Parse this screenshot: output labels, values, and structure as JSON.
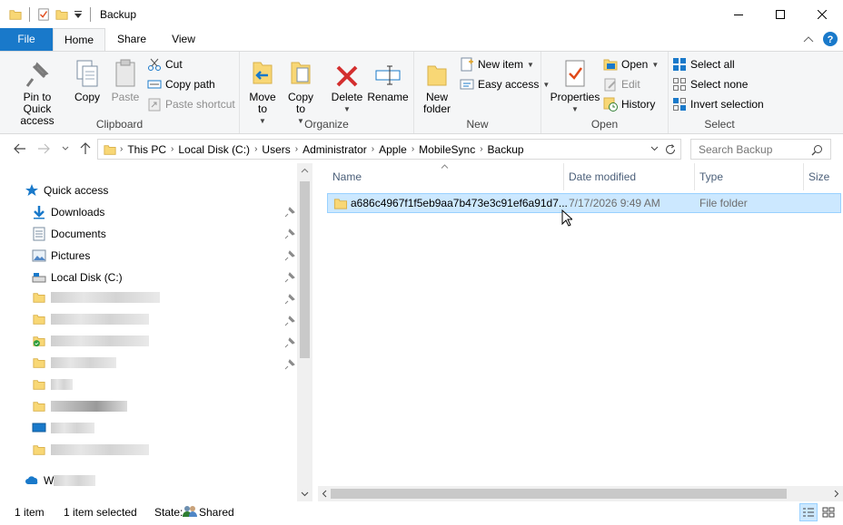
{
  "window": {
    "title": "Backup"
  },
  "ribbon_tabs": {
    "file": "File",
    "home": "Home",
    "share": "Share",
    "view": "View"
  },
  "clipboard": {
    "pin": "Pin to Quick access",
    "copy": "Copy",
    "paste": "Paste",
    "cut": "Cut",
    "copy_path": "Copy path",
    "paste_shortcut": "Paste shortcut",
    "label": "Clipboard"
  },
  "organize": {
    "move_to": "Move to",
    "copy_to": "Copy to",
    "delete": "Delete",
    "rename": "Rename",
    "label": "Organize"
  },
  "new": {
    "new_folder": "New folder",
    "new_item": "New item",
    "easy_access": "Easy access",
    "label": "New"
  },
  "open": {
    "properties": "Properties",
    "open": "Open",
    "edit": "Edit",
    "history": "History",
    "label": "Open"
  },
  "select": {
    "select_all": "Select all",
    "select_none": "Select none",
    "invert": "Invert selection",
    "label": "Select"
  },
  "address": {
    "breadcrumbs": [
      "This PC",
      "Local Disk (C:)",
      "Users",
      "Administrator",
      "Apple",
      "MobileSync",
      "Backup"
    ],
    "search_placeholder": "Search Backup"
  },
  "nav": {
    "quick_access": "Quick access",
    "downloads": "Downloads",
    "documents": "Documents",
    "pictures": "Pictures",
    "local_disk": "Local Disk (C:)",
    "onedrive_prefix": "W"
  },
  "columns": {
    "name": "Name",
    "date_modified": "Date modified",
    "type": "Type",
    "size": "Size"
  },
  "files": [
    {
      "name": "a686c4967f1f5eb9aa7b473e3c91ef6a91d7...",
      "date": "7/17/2026 9:49 AM",
      "type": "File folder"
    }
  ],
  "status": {
    "count": "1 item",
    "selected": "1 item selected",
    "state_label": "State:",
    "state_value": "Shared"
  },
  "colors": {
    "accent": "#1979ca",
    "selection": "#cce8ff",
    "folder": "#f8d775"
  }
}
